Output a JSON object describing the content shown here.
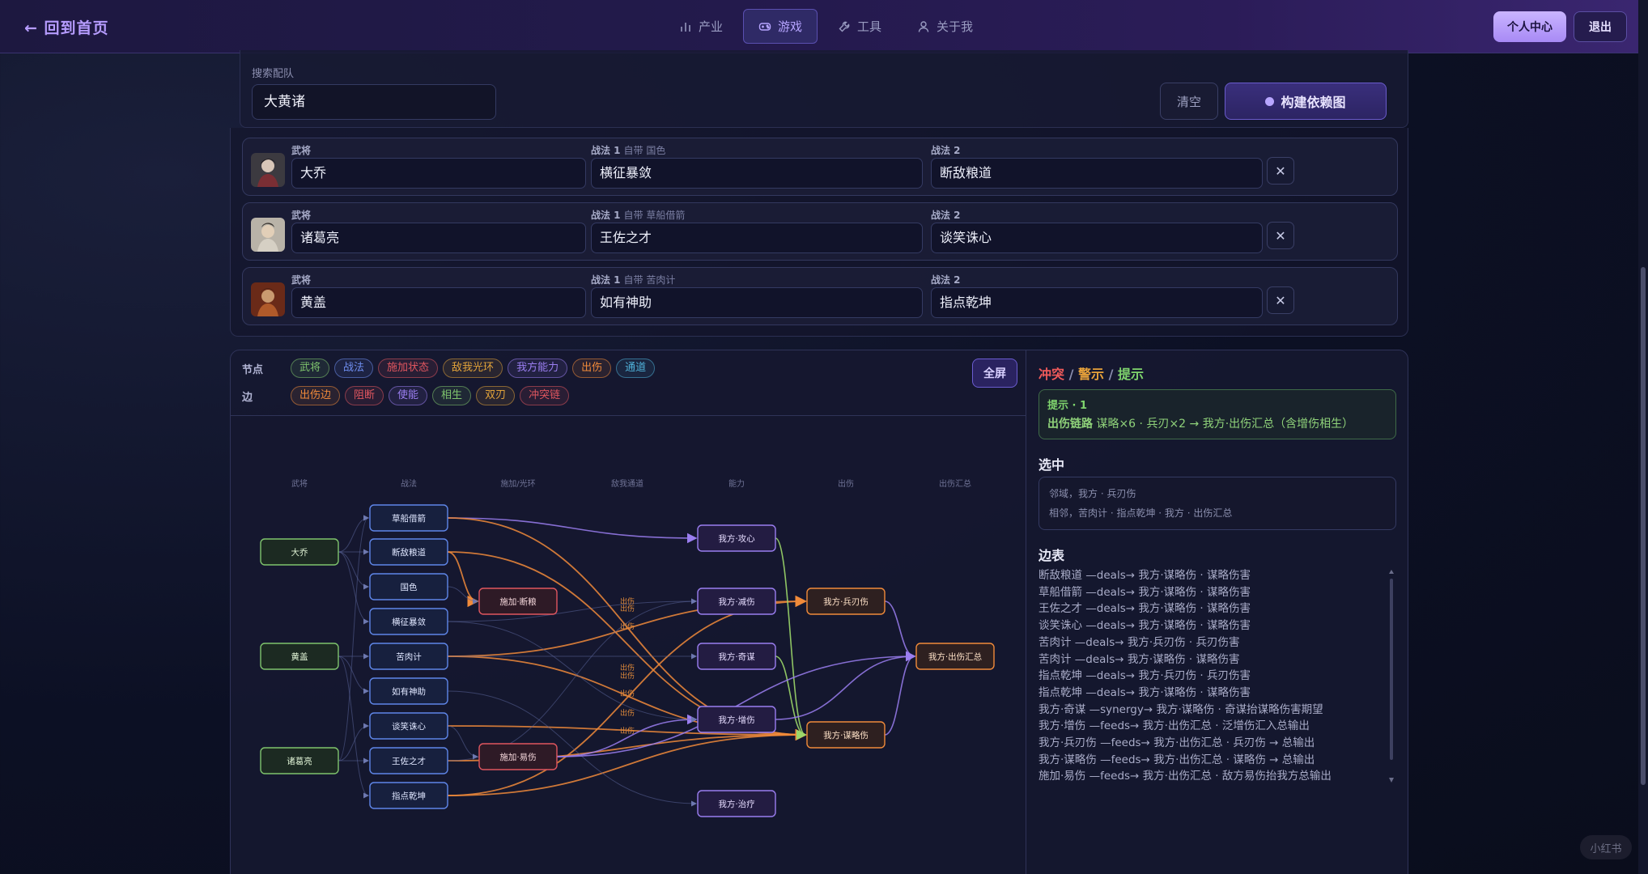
{
  "header": {
    "back_label": "← 回到首页",
    "nav": [
      {
        "label": "产业",
        "icon": "chart-bar-icon",
        "active": false
      },
      {
        "label": "游戏",
        "icon": "gamepad-icon",
        "active": true
      },
      {
        "label": "工具",
        "icon": "wrench-icon",
        "active": false
      },
      {
        "label": "关于我",
        "icon": "user-icon",
        "active": false
      }
    ],
    "profile_label": "个人中心",
    "logout_label": "退出"
  },
  "search": {
    "label": "搜索配队",
    "value": "大黄诸",
    "clear_label": "清空",
    "build_label": "构建依赖图"
  },
  "team": [
    {
      "general_label": "武将",
      "general": "大乔",
      "skill1_label": "战法 1",
      "skill1_sub": "自带 国色",
      "skill1": "横征暴敛",
      "skill2_label": "战法 2",
      "skill2": "断敌粮道"
    },
    {
      "general_label": "武将",
      "general": "诸葛亮",
      "skill1_label": "战法 1",
      "skill1_sub": "自带 草船借箭",
      "skill1": "王佐之才",
      "skill2_label": "战法 2",
      "skill2": "谈笑诛心"
    },
    {
      "general_label": "武将",
      "general": "黄盖",
      "skill1_label": "战法 1",
      "skill1_sub": "自带 苦肉计",
      "skill1": "如有神助",
      "skill2_label": "战法 2",
      "skill2": "指点乾坤"
    }
  ],
  "legend": {
    "nodes_title": "节点",
    "edges_title": "边",
    "node_types": [
      {
        "label": "武将",
        "color": "#7fc46d"
      },
      {
        "label": "战法",
        "color": "#6f8ef0"
      },
      {
        "label": "施加状态",
        "color": "#e0565f"
      },
      {
        "label": "敌我光环",
        "color": "#e0a23a"
      },
      {
        "label": "我方能力",
        "color": "#9a7ef0"
      },
      {
        "label": "出伤",
        "color": "#f08a3a"
      },
      {
        "label": "通道",
        "color": "#4fb0d8"
      }
    ],
    "edge_types": [
      {
        "label": "出伤边",
        "color": "#f08a3a"
      },
      {
        "label": "阻断",
        "color": "#e0565f"
      },
      {
        "label": "使能",
        "color": "#9a7ef0"
      },
      {
        "label": "相生",
        "color": "#7fc46d"
      },
      {
        "label": "双刃",
        "color": "#e0a23a"
      },
      {
        "label": "冲突链",
        "color": "#e0565f"
      }
    ],
    "fullscreen_label": "全屏"
  },
  "graph": {
    "columns": [
      "武将",
      "战法",
      "施加/光环",
      "敌我通道",
      "能力",
      "出伤",
      "出伤汇总"
    ],
    "nodes": [
      {
        "id": "g1",
        "label": "大乔",
        "type": "general"
      },
      {
        "id": "g2",
        "label": "黄盖",
        "type": "general"
      },
      {
        "id": "g3",
        "label": "诸葛亮",
        "type": "general"
      },
      {
        "id": "s1",
        "label": "草船借箭",
        "type": "skill"
      },
      {
        "id": "s2",
        "label": "断敌粮道",
        "type": "skill"
      },
      {
        "id": "s3",
        "label": "国色",
        "type": "skill"
      },
      {
        "id": "s4",
        "label": "横征暴敛",
        "type": "skill"
      },
      {
        "id": "s5",
        "label": "苦肉计",
        "type": "skill"
      },
      {
        "id": "s6",
        "label": "如有神助",
        "type": "skill"
      },
      {
        "id": "s7",
        "label": "谈笑诛心",
        "type": "skill"
      },
      {
        "id": "s8",
        "label": "王佐之才",
        "type": "skill"
      },
      {
        "id": "s9",
        "label": "指点乾坤",
        "type": "skill"
      },
      {
        "id": "st1",
        "label": "施加·断粮",
        "type": "status"
      },
      {
        "id": "st2",
        "label": "施加·易伤",
        "type": "status"
      },
      {
        "id": "a1",
        "label": "我方·攻心",
        "type": "ability"
      },
      {
        "id": "a2",
        "label": "我方·减伤",
        "type": "ability"
      },
      {
        "id": "a3",
        "label": "我方·奇谋",
        "type": "ability"
      },
      {
        "id": "a4",
        "label": "我方·增伤",
        "type": "ability"
      },
      {
        "id": "a5",
        "label": "我方·治疗",
        "type": "ability"
      },
      {
        "id": "d1",
        "label": "我方·兵刃伤",
        "type": "damage"
      },
      {
        "id": "d2",
        "label": "我方·谋略伤",
        "type": "damage"
      },
      {
        "id": "t1",
        "label": "我方·出伤汇总",
        "type": "damage"
      }
    ],
    "edge_label": "出伤",
    "edges": [
      {
        "from": "g1",
        "to": "s1",
        "kind": "link"
      },
      {
        "from": "g1",
        "to": "s2",
        "kind": "link"
      },
      {
        "from": "g1",
        "to": "s3",
        "kind": "link"
      },
      {
        "from": "g1",
        "to": "s4",
        "kind": "link"
      },
      {
        "from": "g2",
        "to": "s5",
        "kind": "link"
      },
      {
        "from": "g2",
        "to": "s6",
        "kind": "link"
      },
      {
        "from": "g2",
        "to": "s9",
        "kind": "link"
      },
      {
        "from": "g3",
        "to": "s7",
        "kind": "link"
      },
      {
        "from": "g3",
        "to": "s8",
        "kind": "link"
      },
      {
        "from": "g3",
        "to": "s1",
        "kind": "link"
      },
      {
        "from": "s2",
        "to": "st1",
        "kind": "damage"
      },
      {
        "from": "s3",
        "to": "st1",
        "kind": "link"
      },
      {
        "from": "s1",
        "to": "a1",
        "kind": "enable"
      },
      {
        "from": "s4",
        "to": "a2",
        "kind": "link"
      },
      {
        "from": "s5",
        "to": "d1",
        "kind": "damage"
      },
      {
        "from": "s5",
        "to": "d2",
        "kind": "damage"
      },
      {
        "from": "s9",
        "to": "d1",
        "kind": "damage"
      },
      {
        "from": "s9",
        "to": "d2",
        "kind": "damage"
      },
      {
        "from": "s1",
        "to": "d2",
        "kind": "damage"
      },
      {
        "from": "s2",
        "to": "d2",
        "kind": "damage"
      },
      {
        "from": "s8",
        "to": "d2",
        "kind": "damage"
      },
      {
        "from": "s7",
        "to": "d2",
        "kind": "damage"
      },
      {
        "from": "s7",
        "to": "st2",
        "kind": "link"
      },
      {
        "from": "st2",
        "to": "a4",
        "kind": "enable"
      },
      {
        "from": "s6",
        "to": "a5",
        "kind": "link"
      },
      {
        "from": "a3",
        "to": "d2",
        "kind": "synergy"
      },
      {
        "from": "a1",
        "to": "d2",
        "kind": "synergy"
      },
      {
        "from": "a4",
        "to": "t1",
        "kind": "enable"
      },
      {
        "from": "d1",
        "to": "t1",
        "kind": "enable"
      },
      {
        "from": "d2",
        "to": "t1",
        "kind": "enable"
      },
      {
        "from": "st2",
        "to": "t1",
        "kind": "enable"
      },
      {
        "from": "s5",
        "to": "a3",
        "kind": "link"
      },
      {
        "from": "s4",
        "to": "a4",
        "kind": "link"
      },
      {
        "from": "s8",
        "to": "a2",
        "kind": "link"
      }
    ]
  },
  "side": {
    "heading_conflict": "冲突",
    "heading_warn": "警示",
    "heading_tip": "提示",
    "heading_sep": "/",
    "tip_title": "提示 · 1",
    "tip_bold": "出伤链路",
    "tip_text": "谋略×6 · 兵刃×2 → 我方·出伤汇总（含增伤相生）",
    "selected_title": "选中",
    "selected_line1": "邻域，我方 · 兵刃伤",
    "selected_line2": "相邻，苦肉计 · 指点乾坤 · 我方 · 出伤汇总",
    "edges_title": "边表",
    "edge_rows": [
      "断敌粮道 —deals→ 我方·谋略伤 · 谋略伤害",
      "草船借箭 —deals→ 我方·谋略伤 · 谋略伤害",
      "王佐之才 —deals→ 我方·谋略伤 · 谋略伤害",
      "谈笑诛心 —deals→ 我方·谋略伤 · 谋略伤害",
      "苦肉计 —deals→ 我方·兵刃伤 · 兵刃伤害",
      "苦肉计 —deals→ 我方·谋略伤 · 谋略伤害",
      "指点乾坤 —deals→ 我方·兵刃伤 · 兵刃伤害",
      "指点乾坤 —deals→ 我方·谋略伤 · 谋略伤害",
      "我方·奇谋 —synergy→ 我方·谋略伤 · 奇谋抬谋略伤害期望",
      "我方·增伤 —feeds→ 我方·出伤汇总 · 泛增伤汇入总输出",
      "我方·兵刃伤 —feeds→ 我方·出伤汇总 · 兵刃伤 → 总输出",
      "我方·谋略伤 —feeds→ 我方·出伤汇总 · 谋略伤 → 总输出",
      "施加·易伤 —feeds→ 我方·出伤汇总 · 敌方易伤抬我方总输出"
    ]
  },
  "watermark": "小红书"
}
